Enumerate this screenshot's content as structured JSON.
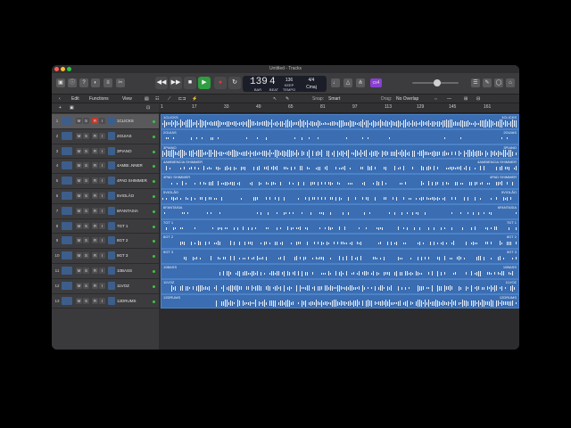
{
  "window": {
    "title": "Untitled - Tracks"
  },
  "lcd": {
    "bars": "139",
    "beats": "4",
    "bar_label": "BAR",
    "beat_label": "BEAT",
    "tempo": "136",
    "tempo_label": "KEEP",
    "tempo_sub": "TEMPO",
    "signature": "4/4",
    "key": "Cmaj"
  },
  "toolbar": {
    "rec_badge": "cs4"
  },
  "editbar": {
    "edit": "Edit",
    "functions": "Functions",
    "view": "View",
    "snap_label": "Snap:",
    "snap_value": "Smart",
    "drag_label": "Drag:",
    "drag_value": "No Overlap"
  },
  "ruler": {
    "marks": [
      "1",
      "17",
      "33",
      "49",
      "65",
      "81",
      "97",
      "113",
      "129",
      "145",
      "161"
    ]
  },
  "track_buttons": {
    "mute": "M",
    "solo": "S",
    "rec": "R",
    "input": "I"
  },
  "tracks": [
    {
      "num": "1",
      "name": "1CLICKS",
      "region": "1CLICKS"
    },
    {
      "num": "2",
      "name": "2GUIAS",
      "region": "2GUIAS"
    },
    {
      "num": "3",
      "name": "3PIANO",
      "region": "3PIANO"
    },
    {
      "num": "4",
      "name": "4AMBI..NNER",
      "region": "4AMBIENCIA SHIMMER"
    },
    {
      "num": "5",
      "name": "4PAD SHIMMER",
      "region": "4PAD SHIMMER"
    },
    {
      "num": "6",
      "name": "5VIOLÃO",
      "region": "5VIOLÃO"
    },
    {
      "num": "7",
      "name": "6FANTASIA",
      "region": "6FANTASIA"
    },
    {
      "num": "8",
      "name": "7GT 1",
      "region": "7GT 1"
    },
    {
      "num": "9",
      "name": "8GT 2",
      "region": "8GT 2"
    },
    {
      "num": "10",
      "name": "9GT 3",
      "region": "9GT 3"
    },
    {
      "num": "11",
      "name": "10BASS",
      "region": "10BASS"
    },
    {
      "num": "12",
      "name": "11VOZ",
      "region": "11VOZ"
    },
    {
      "num": "13",
      "name": "12DRUMS",
      "region": "12DRUMS"
    }
  ],
  "colors": {
    "region": "#3a6db2",
    "play": "#2e9e3e",
    "record": "#e03a3a",
    "accent_purple": "#8a3fd1"
  }
}
